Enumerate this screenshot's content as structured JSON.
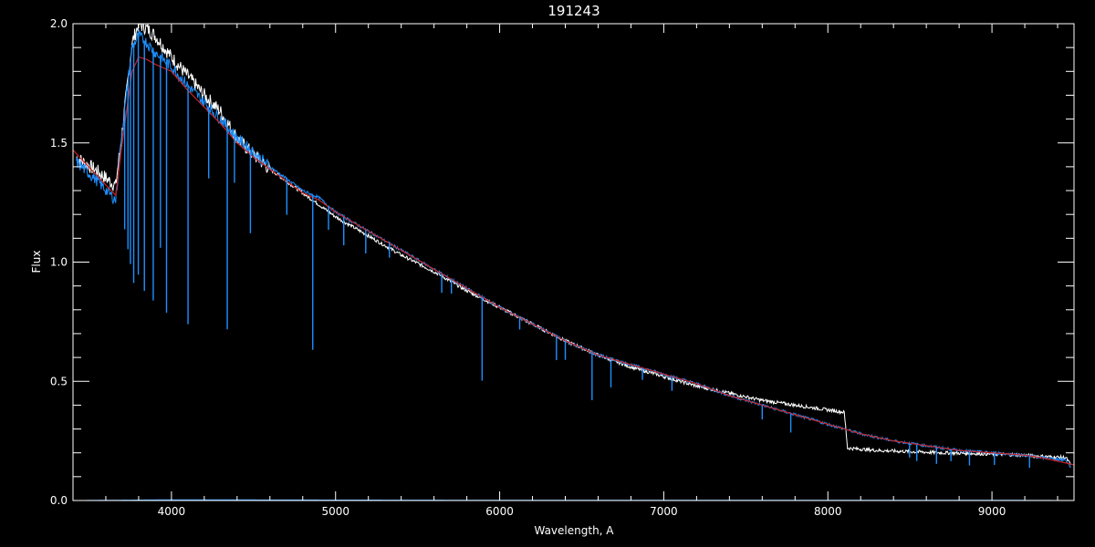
{
  "chart_data": {
    "type": "line",
    "title": "191243",
    "xlabel": "Wavelength, A",
    "ylabel": "Flux",
    "xlim": [
      3400,
      9500
    ],
    "ylim": [
      0.0,
      2.0
    ],
    "xticks": [
      4000,
      5000,
      6000,
      7000,
      8000,
      9000
    ],
    "xtick_labels": [
      "4000",
      "5000",
      "6000",
      "7000",
      "8000",
      "9000"
    ],
    "yticks": [
      0.0,
      0.5,
      1.0,
      1.5,
      2.0
    ],
    "ytick_labels": [
      "0.0",
      "0.5",
      "1.0",
      "1.5",
      "2.0"
    ],
    "grid": false,
    "background": "#000000",
    "axis_color": "#ffffff",
    "series": [
      {
        "color": "#ffffff",
        "x": [
          3420,
          3550,
          3660,
          3700,
          3760,
          3800,
          3850,
          3900,
          4000,
          4100,
          4200,
          4300,
          4400,
          4500,
          4600,
          4700,
          4800,
          4900,
          5000,
          5200,
          5400,
          5600,
          5800,
          6000,
          6200,
          6400,
          6600,
          6800,
          7000,
          7200,
          7400,
          7600,
          7800,
          8000,
          8100,
          8120,
          8300,
          8500,
          8700,
          9000,
          9200,
          9300,
          9450,
          9480
        ],
        "y": [
          1.44,
          1.38,
          1.32,
          1.55,
          1.92,
          2.0,
          1.98,
          1.95,
          1.86,
          1.78,
          1.7,
          1.63,
          1.52,
          1.45,
          1.39,
          1.34,
          1.29,
          1.24,
          1.19,
          1.11,
          1.03,
          0.96,
          0.88,
          0.81,
          0.74,
          0.67,
          0.61,
          0.56,
          0.52,
          0.48,
          0.45,
          0.42,
          0.4,
          0.38,
          0.37,
          0.22,
          0.21,
          0.205,
          0.2,
          0.195,
          0.19,
          0.185,
          0.18,
          0.15
        ]
      },
      {
        "color": "#1e90ff",
        "x": [
          3420,
          3550,
          3660,
          3700,
          3760,
          3800,
          3850,
          3900,
          4000,
          4100,
          4200,
          4300,
          4400,
          4500,
          4600,
          4700,
          4800,
          4900,
          5000,
          5200,
          5400,
          5600,
          5800,
          6000,
          6200,
          6400,
          6600,
          6800,
          7000,
          7200,
          7400,
          7600,
          7800,
          8000,
          8100,
          8200,
          8400,
          8600,
          8800,
          9000,
          9200,
          9300,
          9450,
          9480
        ],
        "y": [
          1.42,
          1.34,
          1.26,
          1.55,
          1.9,
          1.95,
          1.92,
          1.88,
          1.82,
          1.74,
          1.67,
          1.6,
          1.52,
          1.46,
          1.4,
          1.35,
          1.3,
          1.27,
          1.21,
          1.13,
          1.05,
          0.97,
          0.89,
          0.81,
          0.74,
          0.67,
          0.61,
          0.57,
          0.53,
          0.49,
          0.44,
          0.4,
          0.36,
          0.32,
          0.3,
          0.28,
          0.25,
          0.23,
          0.21,
          0.2,
          0.19,
          0.18,
          0.17,
          0.14
        ]
      },
      {
        "color": "#cc2222",
        "x": [
          3400,
          3550,
          3660,
          3700,
          3760,
          3800,
          3850,
          3900,
          4000,
          4100,
          4200,
          4300,
          4400,
          4500,
          4600,
          4700,
          4800,
          4900,
          5000,
          5200,
          5400,
          5600,
          5800,
          6000,
          6200,
          6400,
          6600,
          6800,
          7000,
          7200,
          7400,
          7600,
          7800,
          8000,
          8100,
          8200,
          8400,
          8600,
          8800,
          9000,
          9200,
          9300,
          9500
        ],
        "y": [
          1.47,
          1.36,
          1.28,
          1.5,
          1.8,
          1.86,
          1.85,
          1.83,
          1.8,
          1.72,
          1.65,
          1.58,
          1.5,
          1.44,
          1.39,
          1.34,
          1.29,
          1.26,
          1.21,
          1.13,
          1.05,
          0.97,
          0.89,
          0.81,
          0.74,
          0.67,
          0.61,
          0.57,
          0.53,
          0.49,
          0.44,
          0.4,
          0.36,
          0.32,
          0.3,
          0.28,
          0.25,
          0.23,
          0.21,
          0.2,
          0.19,
          0.18,
          0.15
        ]
      },
      {
        "color": "#1e90ff",
        "x": [
          3450,
          4000,
          5000,
          6000,
          7000,
          8000,
          9000,
          9450
        ],
        "y": [
          0.0,
          0.003,
          0.002,
          0.001,
          0.001,
          0.001,
          0.001,
          0.0
        ]
      }
    ],
    "absorption_lines": [
      {
        "x": 3715,
        "depth": 0.5
      },
      {
        "x": 3735,
        "depth": 0.7
      },
      {
        "x": 3750,
        "depth": 0.85
      },
      {
        "x": 3770,
        "depth": 1.0
      },
      {
        "x": 3798,
        "depth": 1.0
      },
      {
        "x": 3835,
        "depth": 1.05
      },
      {
        "x": 3889,
        "depth": 1.05
      },
      {
        "x": 3933,
        "depth": 0.8
      },
      {
        "x": 3970,
        "depth": 1.05
      },
      {
        "x": 4101,
        "depth": 1.0
      },
      {
        "x": 4227,
        "depth": 0.3
      },
      {
        "x": 4340,
        "depth": 0.85
      },
      {
        "x": 4384,
        "depth": 0.2
      },
      {
        "x": 4481,
        "depth": 0.35
      },
      {
        "x": 4703,
        "depth": 0.15
      },
      {
        "x": 4861,
        "depth": 0.65
      },
      {
        "x": 4957,
        "depth": 0.1
      },
      {
        "x": 5050,
        "depth": 0.12
      },
      {
        "x": 5184,
        "depth": 0.1
      },
      {
        "x": 5328,
        "depth": 0.06
      },
      {
        "x": 5647,
        "depth": 0.08
      },
      {
        "x": 5706,
        "depth": 0.06
      },
      {
        "x": 5893,
        "depth": 0.35
      },
      {
        "x": 6122,
        "depth": 0.05
      },
      {
        "x": 6346,
        "depth": 0.1
      },
      {
        "x": 6400,
        "depth": 0.08
      },
      {
        "x": 6563,
        "depth": 0.2
      },
      {
        "x": 6678,
        "depth": 0.12
      },
      {
        "x": 6870,
        "depth": 0.05
      },
      {
        "x": 7050,
        "depth": 0.06
      },
      {
        "x": 7600,
        "depth": 0.06
      },
      {
        "x": 7774,
        "depth": 0.08
      },
      {
        "x": 8498,
        "depth": 0.06
      },
      {
        "x": 8542,
        "depth": 0.07
      },
      {
        "x": 8662,
        "depth": 0.07
      },
      {
        "x": 8750,
        "depth": 0.05
      },
      {
        "x": 8863,
        "depth": 0.06
      },
      {
        "x": 9015,
        "depth": 0.05
      },
      {
        "x": 9229,
        "depth": 0.05
      }
    ]
  }
}
